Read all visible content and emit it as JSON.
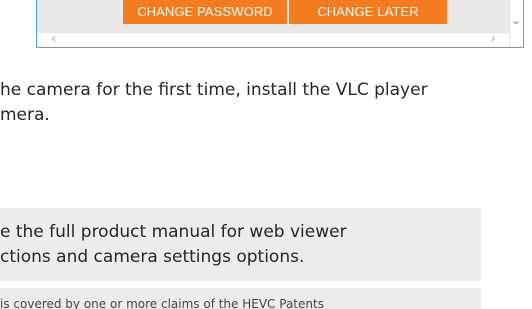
{
  "embed": {
    "buttons": {
      "change_password": "CHANGE PASSWORD",
      "change_later": "CHANGE LATER"
    },
    "scroll_left_glyph": "‹",
    "scroll_right_glyph": "›",
    "scroll_down_glyph": "⌄",
    "colors": {
      "button": "#f47c20",
      "frame_border": "#4aa3df"
    }
  },
  "instructions": {
    "line1": "he camera for the first time, install the VLC player",
    "line2": "mera."
  },
  "note": {
    "line1": "e the full product manual for web viewer",
    "line2": "ctions and camera settings options."
  },
  "legal": {
    "text": "is covered by one or more claims of the HEVC Patents"
  }
}
